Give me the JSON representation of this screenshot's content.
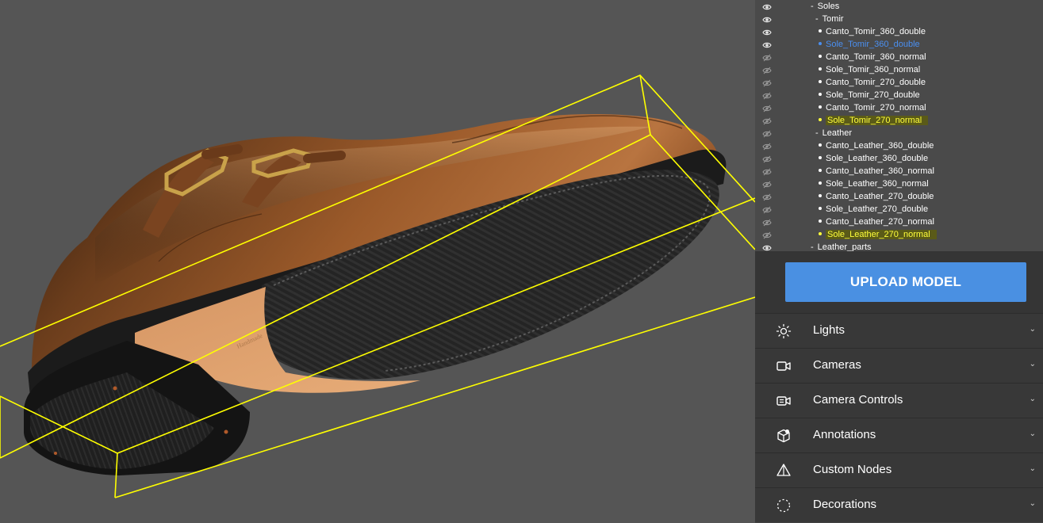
{
  "tree": {
    "items": [
      {
        "label": "Soles",
        "kind": "group",
        "depth": 0,
        "eye": "visible"
      },
      {
        "label": "Tomir",
        "kind": "group",
        "depth": 1,
        "eye": "visible"
      },
      {
        "label": "Canto_Tomir_360_double",
        "kind": "node",
        "depth": 2,
        "eye": "visible",
        "state": ""
      },
      {
        "label": "Sole_Tomir_360_double",
        "kind": "node",
        "depth": 2,
        "eye": "visible",
        "state": "selected"
      },
      {
        "label": "Canto_Tomir_360_normal",
        "kind": "node",
        "depth": 2,
        "eye": "hidden",
        "state": ""
      },
      {
        "label": "Sole_Tomir_360_normal",
        "kind": "node",
        "depth": 2,
        "eye": "hidden",
        "state": ""
      },
      {
        "label": "Canto_Tomir_270_double",
        "kind": "node",
        "depth": 2,
        "eye": "hidden",
        "state": ""
      },
      {
        "label": "Sole_Tomir_270_double",
        "kind": "node",
        "depth": 2,
        "eye": "hidden",
        "state": ""
      },
      {
        "label": "Canto_Tomir_270_normal",
        "kind": "node",
        "depth": 2,
        "eye": "hidden",
        "state": ""
      },
      {
        "label": "Sole_Tomir_270_normal",
        "kind": "node",
        "depth": 2,
        "eye": "hidden",
        "state": "highlighted"
      },
      {
        "label": "Leather",
        "kind": "group",
        "depth": 1,
        "eye": "hidden"
      },
      {
        "label": "Canto_Leather_360_double",
        "kind": "node",
        "depth": 2,
        "eye": "hidden",
        "state": ""
      },
      {
        "label": "Sole_Leather_360_double",
        "kind": "node",
        "depth": 2,
        "eye": "hidden",
        "state": ""
      },
      {
        "label": "Canto_Leather_360_normal",
        "kind": "node",
        "depth": 2,
        "eye": "hidden",
        "state": ""
      },
      {
        "label": "Sole_Leather_360_normal",
        "kind": "node",
        "depth": 2,
        "eye": "hidden",
        "state": ""
      },
      {
        "label": "Canto_Leather_270_double",
        "kind": "node",
        "depth": 2,
        "eye": "hidden",
        "state": ""
      },
      {
        "label": "Sole_Leather_270_double",
        "kind": "node",
        "depth": 2,
        "eye": "hidden",
        "state": ""
      },
      {
        "label": "Canto_Leather_270_normal",
        "kind": "node",
        "depth": 2,
        "eye": "hidden",
        "state": ""
      },
      {
        "label": "Sole_Leather_270_normal",
        "kind": "node",
        "depth": 2,
        "eye": "hidden",
        "state": "highlighted"
      },
      {
        "label": "Leather_parts",
        "kind": "group",
        "depth": 0,
        "eye": "visible"
      }
    ]
  },
  "upload": {
    "label": "UPLOAD MODEL"
  },
  "sections": [
    {
      "label": "Lights",
      "icon": "sun-icon",
      "chevron": "⌄"
    },
    {
      "label": "Cameras",
      "icon": "video-camera-icon",
      "chevron": "⌄"
    },
    {
      "label": "Camera Controls",
      "icon": "camera-controls-icon",
      "chevron": "⌄"
    },
    {
      "label": "Annotations",
      "icon": "cube-annotation-icon",
      "chevron": "⌄"
    },
    {
      "label": "Custom Nodes",
      "icon": "pyramid-icon",
      "chevron": "⌄"
    },
    {
      "label": "Decorations",
      "icon": "dashed-circle-icon",
      "chevron": "⌄"
    }
  ],
  "colors": {
    "viewport_bg": "#555555",
    "panel_bg": "#424242",
    "accent": "#4a90e2",
    "bounding_box": "#ffff00",
    "highlight_text": "#ffff3a",
    "selected_text": "#4a8ff0"
  }
}
